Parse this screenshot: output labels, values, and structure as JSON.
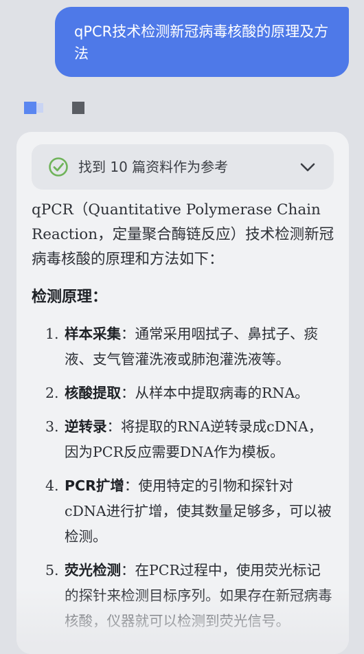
{
  "user_message": "qPCR技术检测新冠病毒核酸的原理及方法",
  "sources": {
    "label": "找到 10 篇资料作为参考",
    "check_icon": "check-circle-icon",
    "check_color": "#6fb35a",
    "chevron_icon": "chevron-down-icon"
  },
  "answer": {
    "intro": "qPCR（Quantitative Polymerase Chain Reaction，定量聚合酶链反应）技术检测新冠病毒核酸的原理和方法如下：",
    "section_title": "检测原理：",
    "steps": [
      {
        "num": "1.",
        "term": "样本采集",
        "text": "：通常采用咽拭子、鼻拭子、痰液、支气管灌洗液或肺泡灌洗液等。"
      },
      {
        "num": "2.",
        "term": "核酸提取",
        "text": "：从样本中提取病毒的RNA。"
      },
      {
        "num": "3.",
        "term": "逆转录",
        "text": "：将提取的RNA逆转录成cDNA，因为PCR反应需要DNA作为模板。"
      },
      {
        "num": "4.",
        "term": "PCR扩增",
        "text": "：使用特定的引物和探针对cDNA进行扩增，使其数量足够多，可以被检测。"
      },
      {
        "num": "5.",
        "term": "荧光检测",
        "text": "：在PCR过程中，使用荧光标记的探针来检测目标序列。如果存在新冠病毒核酸，仪器就可以检测到荧光信号。"
      }
    ]
  },
  "colors": {
    "accent": "#4e79e8",
    "background": "#dfe1e6",
    "card": "#f1f2f4"
  }
}
